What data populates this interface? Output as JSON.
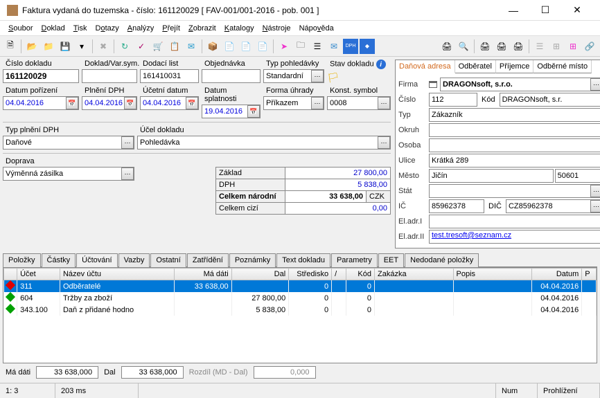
{
  "window": {
    "title": "Faktura vydaná do tuzemska - číslo: 161120029  [ FAV-001/001-2016 - pob. 001 ]"
  },
  "menu": [
    "Soubor",
    "Doklad",
    "Tisk",
    "Dotazy",
    "Analýzy",
    "Přejít",
    "Zobrazit",
    "Katalogy",
    "Nástroje",
    "Nápověda"
  ],
  "fields": {
    "cislo_dokladu_l": "Číslo dokladu",
    "cislo_dokladu": "161120029",
    "doklad_vs_l": "Doklad/Var.sym.",
    "doklad_vs": "",
    "dodaci_list_l": "Dodací list",
    "dodaci_list": "161410031",
    "objednavka_l": "Objednávka",
    "objednavka": "",
    "typ_pohl_l": "Typ pohledávky",
    "typ_pohl": "Standardní",
    "stav_dokladu_l": "Stav dokladu",
    "datum_porizeni_l": "Datum pořízení",
    "datum_porizeni": "04.04.2016",
    "plneni_dph_l": "Plnění DPH",
    "plneni_dph": "04.04.2016",
    "ucetni_datum_l": "Účetní datum",
    "ucetni_datum": "04.04.2016",
    "datum_splatnosti_l": "Datum splatnosti",
    "datum_splatnosti": "19.04.2016",
    "forma_uhrady_l": "Forma úhrady",
    "forma_uhrady": "Příkazem",
    "konst_symbol_l": "Konst. symbol",
    "konst_symbol": "0008",
    "typ_plneni_l": "Typ plnění DPH",
    "typ_plneni": "Daňové",
    "ucel_dokladu_l": "Účel dokladu",
    "ucel_dokladu": "Pohledávka",
    "doprava_l": "Doprava",
    "doprava": "Výměnná zásilka"
  },
  "sum": {
    "zaklad_l": "Základ",
    "zaklad": "27 800,00",
    "dph_l": "DPH",
    "dph": "5 838,00",
    "celkem_n_l": "Celkem národní",
    "celkem_n": "33 638,00",
    "mena": "CZK",
    "celkem_c_l": "Celkem cizí",
    "celkem_c": "0,00"
  },
  "rtabs": [
    "Daňová adresa",
    "Odběratel",
    "Příjemce",
    "Odběrné místo"
  ],
  "addr": {
    "firma_l": "Firma",
    "firma": "DRAGONsoft, s.r.o.",
    "cislo_l": "Číslo",
    "cislo": "112",
    "kod_l": "Kód",
    "kod": "DRAGONsoft, s.r.",
    "typ_l": "Typ",
    "typ": "Zákazník",
    "okruh_l": "Okruh",
    "okruh": "",
    "osoba_l": "Osoba",
    "osoba": "",
    "ulice_l": "Ulice",
    "ulice": "Krátká 289",
    "mesto_l": "Město",
    "mesto": "Jičín",
    "psc": "50601",
    "stat_l": "Stát",
    "stat": "",
    "ic_l": "IČ",
    "ic": "85962378",
    "dic_l": "DIČ",
    "dic": "CZ85962378",
    "eladr1_l": "El.adr.I",
    "eladr1": "",
    "eladr2_l": "El.adr.II",
    "eladr2": "test.tresoft@seznam.cz"
  },
  "ltabs": [
    "Položky",
    "Částky",
    "Účtování",
    "Vazby",
    "Ostatní",
    "Zatřídění",
    "Poznámky",
    "Text dokladu",
    "Parametry",
    "EET",
    "Nedodané položky"
  ],
  "grid": {
    "cols": [
      "",
      "Účet",
      "Název účtu",
      "Má dáti",
      "Dal",
      "Středisko",
      "/",
      "Kód",
      "Zakázka",
      "Popis",
      "Datum",
      "P"
    ],
    "rows": [
      {
        "sel": true,
        "ico": "red",
        "ucet": "311",
        "nazev": "Odběratelé",
        "md": "33 638,00",
        "dal": "",
        "stred": "0",
        "kod1": "",
        "kod2": "0",
        "zak": "",
        "popis": "",
        "datum": "04.04.2016"
      },
      {
        "sel": false,
        "ico": "grn",
        "ucet": "604",
        "nazev": "Tržby za zboží",
        "md": "",
        "dal": "27 800,00",
        "stred": "0",
        "kod1": "",
        "kod2": "0",
        "zak": "",
        "popis": "",
        "datum": "04.04.2016"
      },
      {
        "sel": false,
        "ico": "grn",
        "ucet": "343.100",
        "nazev": "Daň z přidané hodno",
        "md": "",
        "dal": "5 838,00",
        "stred": "0",
        "kod1": "",
        "kod2": "0",
        "zak": "",
        "popis": "",
        "datum": "04.04.2016"
      }
    ]
  },
  "sumbar": {
    "md_l": "Má dáti",
    "md": "33 638,000",
    "dal_l": "Dal",
    "dal": "33 638,000",
    "rozdil_l": "Rozdíl (MD - Dal)",
    "rozdil": "0,000"
  },
  "status": {
    "pos": "1:   3",
    "time": "203 ms",
    "num": "Num",
    "mode": "Prohlížení"
  }
}
